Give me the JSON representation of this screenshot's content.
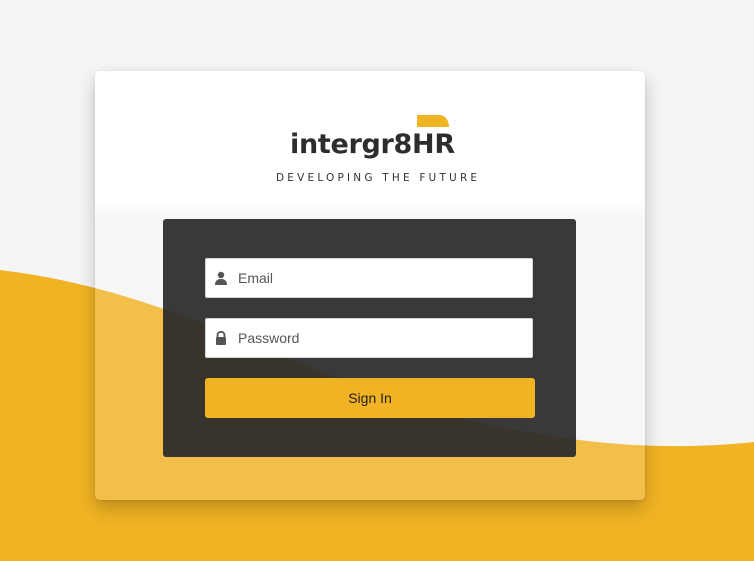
{
  "brand": {
    "name": "intergr8HR",
    "tagline": "DEVELOPING THE FUTURE",
    "accent_color": "#f0b323"
  },
  "login": {
    "email_placeholder": "Email",
    "email_value": "",
    "email_icon": "user-icon",
    "password_placeholder": "Password",
    "password_value": "",
    "password_icon": "lock-icon",
    "submit_label": "Sign In"
  },
  "colors": {
    "page_background": "#f5f5f5",
    "wave": "#f0b323",
    "panel": "#333333",
    "logo_text": "#2d2d2d"
  }
}
